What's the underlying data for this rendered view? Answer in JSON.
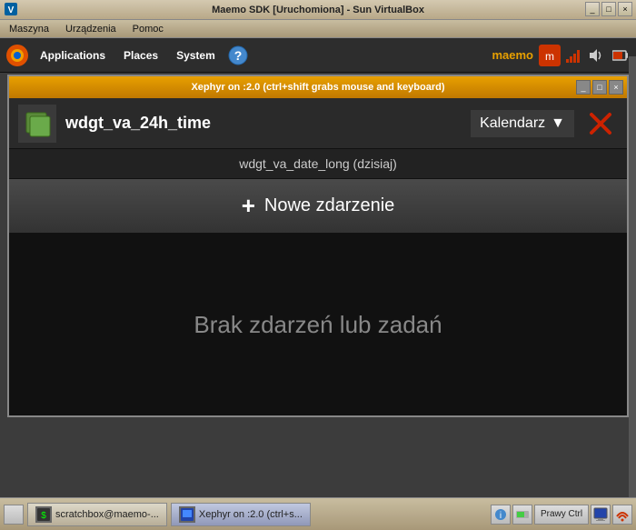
{
  "host": {
    "title": "Maemo SDK [Uruchomiona] - Sun VirtualBox",
    "menu_items": [
      "Maszyna",
      "Urządzenia",
      "Pomoc"
    ],
    "taskbar_left_btn": "",
    "right_btn_minimize": "_",
    "right_btn_maximize": "□",
    "right_btn_close": "×"
  },
  "maemo_taskbar": {
    "applications": "Applications",
    "places": "Places",
    "system": "System",
    "brand": "maemo",
    "right_text": ""
  },
  "xephyr": {
    "title": "Xephyr on :2.0 (ctrl+shift grabs mouse and keyboard)",
    "btn_minimize": "_",
    "btn_maximize": "□",
    "btn_close": "×"
  },
  "app": {
    "widget_name": "wdgt_va_24h_time",
    "dropdown_label": "Kalendarz",
    "dropdown_arrow": "▼",
    "date_label": "wdgt_va_date_long (dzisiaj)",
    "new_event_plus": "+",
    "new_event_label": "Nowe zdarzenie",
    "empty_state": "Brak zdarzeń lub zadań",
    "close_icon": "✕"
  },
  "bottom_taskbar": {
    "item1_icon": "🖥",
    "item1_label": "scratchbox@maemo-...",
    "item2_icon": "🪟",
    "item2_label": "Xephyr on :2.0 (ctrl+s...",
    "right_label": "Prawy Ctrl"
  }
}
